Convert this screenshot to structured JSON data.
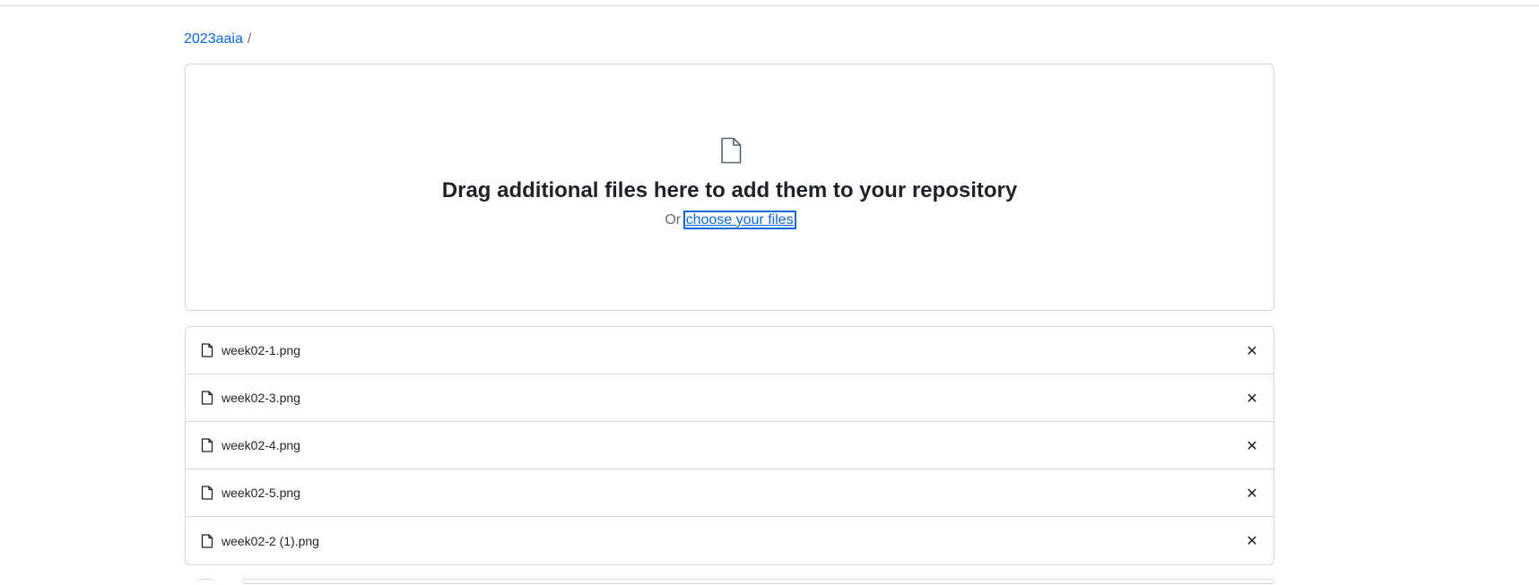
{
  "breadcrumb": {
    "repo": "2023aaia",
    "separator": "/"
  },
  "dropzone": {
    "icon": "file-icon",
    "title": "Drag additional files here to add them to your repository",
    "sub_prefix": "Or",
    "choose_link": "choose your files"
  },
  "files": [
    {
      "name": "week02-1.png",
      "icon": "file-icon",
      "remove": "✕"
    },
    {
      "name": "week02-3.png",
      "icon": "file-icon",
      "remove": "✕"
    },
    {
      "name": "week02-4.png",
      "icon": "file-icon",
      "remove": "✕"
    },
    {
      "name": "week02-5.png",
      "icon": "file-icon",
      "remove": "✕"
    },
    {
      "name": "week02-2 (1).png",
      "icon": "file-icon",
      "remove": "✕"
    }
  ],
  "colors": {
    "link": "#0969da",
    "border": "#d0d7de",
    "text": "#1f2328",
    "muted": "#636c76"
  }
}
